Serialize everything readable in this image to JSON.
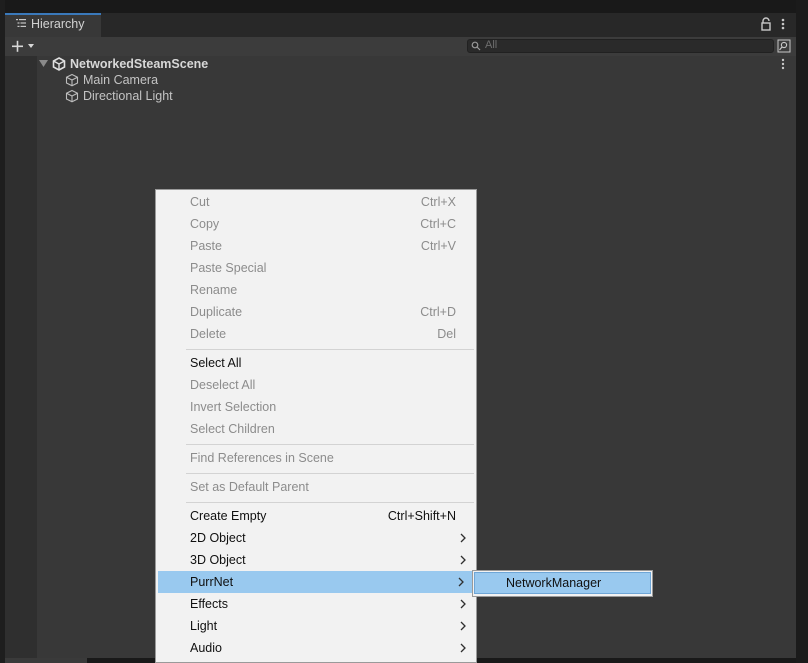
{
  "window": {
    "tab_title": "Hierarchy"
  },
  "toolbar": {
    "search_placeholder": "All"
  },
  "hierarchy": {
    "scene_name": "NetworkedSteamScene",
    "objects": [
      "Main Camera",
      "Directional Light"
    ]
  },
  "context_menu": {
    "items": [
      {
        "label": "Cut",
        "shortcut": "Ctrl+X",
        "enabled": false
      },
      {
        "label": "Copy",
        "shortcut": "Ctrl+C",
        "enabled": false
      },
      {
        "label": "Paste",
        "shortcut": "Ctrl+V",
        "enabled": false
      },
      {
        "label": "Paste Special",
        "shortcut": "",
        "enabled": false
      },
      {
        "label": "Rename",
        "shortcut": "",
        "enabled": false
      },
      {
        "label": "Duplicate",
        "shortcut": "Ctrl+D",
        "enabled": false
      },
      {
        "label": "Delete",
        "shortcut": "Del",
        "enabled": false
      },
      {
        "label": "Select All",
        "shortcut": "",
        "enabled": true
      },
      {
        "label": "Deselect All",
        "shortcut": "",
        "enabled": false
      },
      {
        "label": "Invert Selection",
        "shortcut": "",
        "enabled": false
      },
      {
        "label": "Select Children",
        "shortcut": "",
        "enabled": false
      },
      {
        "label": "Find References in Scene",
        "shortcut": "",
        "enabled": false
      },
      {
        "label": "Set as Default Parent",
        "shortcut": "",
        "enabled": false
      },
      {
        "label": "Create Empty",
        "shortcut": "Ctrl+Shift+N",
        "enabled": true
      },
      {
        "label": "2D Object",
        "shortcut": "",
        "enabled": true,
        "submenu": true
      },
      {
        "label": "3D Object",
        "shortcut": "",
        "enabled": true,
        "submenu": true
      },
      {
        "label": "PurrNet",
        "shortcut": "",
        "enabled": true,
        "submenu": true,
        "highlighted": true
      },
      {
        "label": "Effects",
        "shortcut": "",
        "enabled": true,
        "submenu": true
      },
      {
        "label": "Light",
        "shortcut": "",
        "enabled": true,
        "submenu": true
      },
      {
        "label": "Audio",
        "shortcut": "",
        "enabled": true,
        "submenu": true
      }
    ]
  },
  "submenu": {
    "items": [
      "NetworkManager"
    ]
  },
  "colors": {
    "highlight": "#99c9ef",
    "accent_tab": "#3a79bb",
    "menu_bg": "#f2f2f2"
  }
}
